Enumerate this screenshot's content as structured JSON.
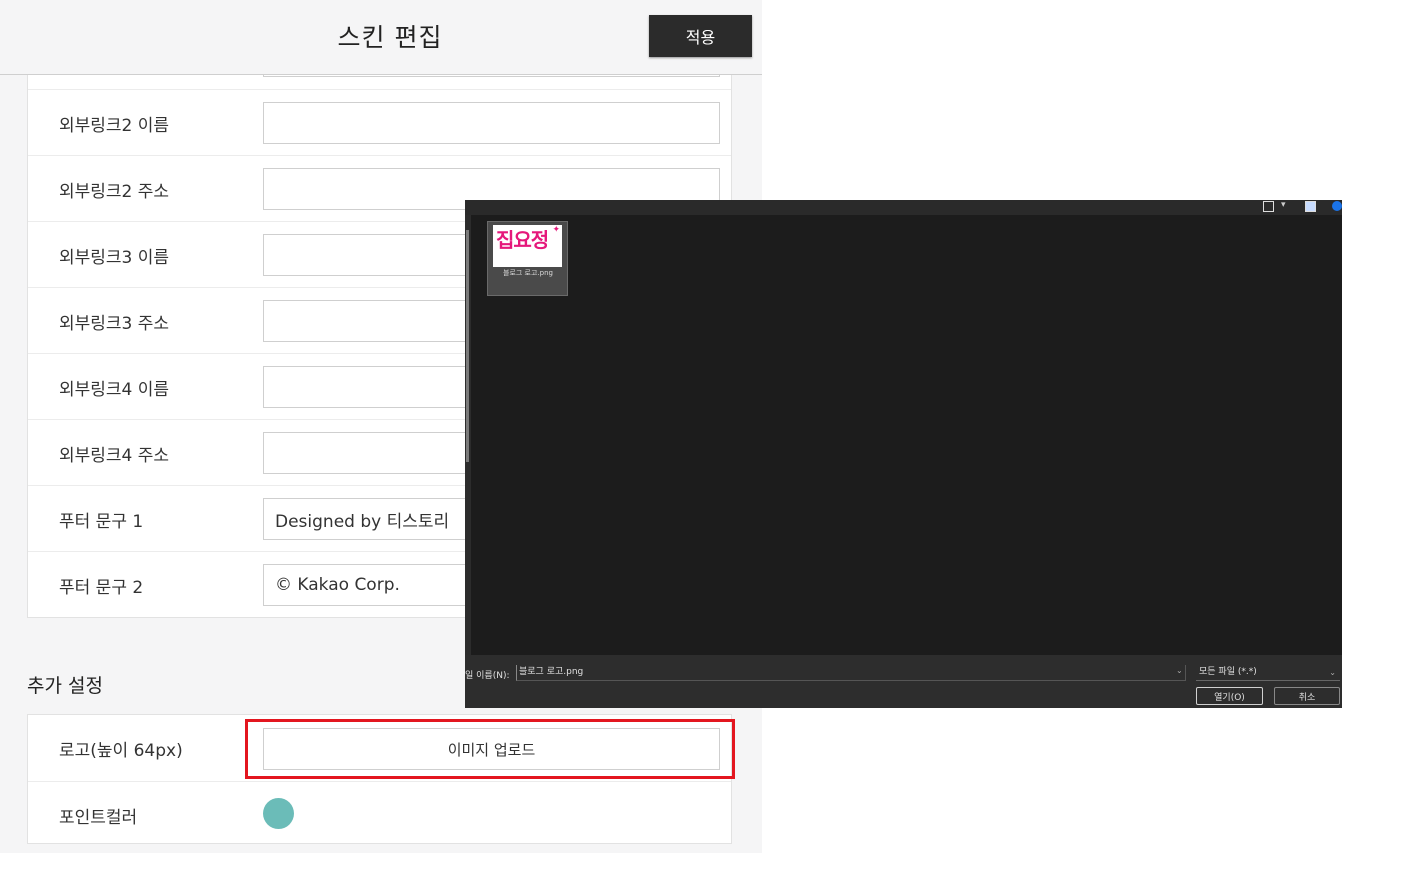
{
  "header": {
    "title": "스킨 편집",
    "apply_label": "적용"
  },
  "settings": {
    "rows": [
      {
        "label": "외부링크2 이름",
        "value": ""
      },
      {
        "label": "외부링크2 주소",
        "value": ""
      },
      {
        "label": "외부링크3 이름",
        "value": ""
      },
      {
        "label": "외부링크3 주소",
        "value": ""
      },
      {
        "label": "외부링크4 이름",
        "value": ""
      },
      {
        "label": "외부링크4 주소",
        "value": ""
      },
      {
        "label": "푸터 문구 1",
        "value": "Designed by 티스토리"
      },
      {
        "label": "푸터 문구 2",
        "value": "© Kakao Corp."
      }
    ]
  },
  "extra": {
    "section_title": "추가 설정",
    "logo_label": "로고(높이 64px)",
    "upload_label": "이미지 업로드",
    "point_color_label": "포인트컬러",
    "point_color": "#6bbcb8"
  },
  "dialog": {
    "file": {
      "logo_text": "집요정",
      "name": "블로그 로고.png"
    },
    "filename_label": "일 이름(N):",
    "filename_value": "블로그 로고.png",
    "filetype_value": "모든 파일 (*.*)",
    "open_label": "열기(O)",
    "cancel_label": "취소"
  },
  "colors": {
    "highlight": "#e3161f",
    "logo_pink": "#e5187b"
  }
}
